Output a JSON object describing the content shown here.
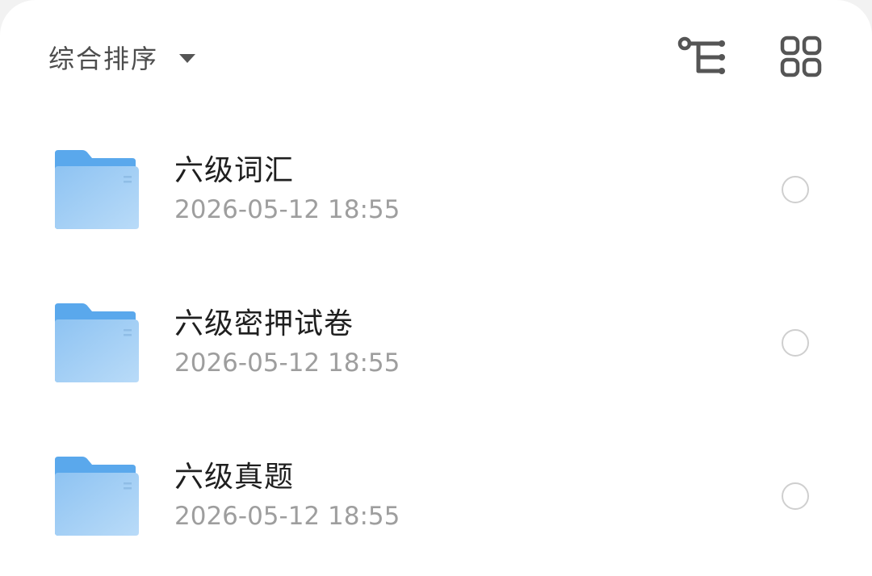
{
  "toolbar": {
    "sort_label": "综合排序",
    "sort_caret_icon": "caret-down-icon",
    "tree_view_icon": "tree-view-icon",
    "grid_view_icon": "grid-view-icon"
  },
  "colors": {
    "folder_front": "#a6d0f5",
    "folder_back": "#5aa8ec",
    "icon": "#555555",
    "radio_border": "#cfcfcf"
  },
  "files": [
    {
      "name": "六级词汇",
      "time": "2026-05-12 18:55",
      "icon": "folder-icon"
    },
    {
      "name": "六级密押试卷",
      "time": "2026-05-12 18:55",
      "icon": "folder-icon"
    },
    {
      "name": "六级真题",
      "time": "2026-05-12 18:55",
      "icon": "folder-icon"
    }
  ]
}
